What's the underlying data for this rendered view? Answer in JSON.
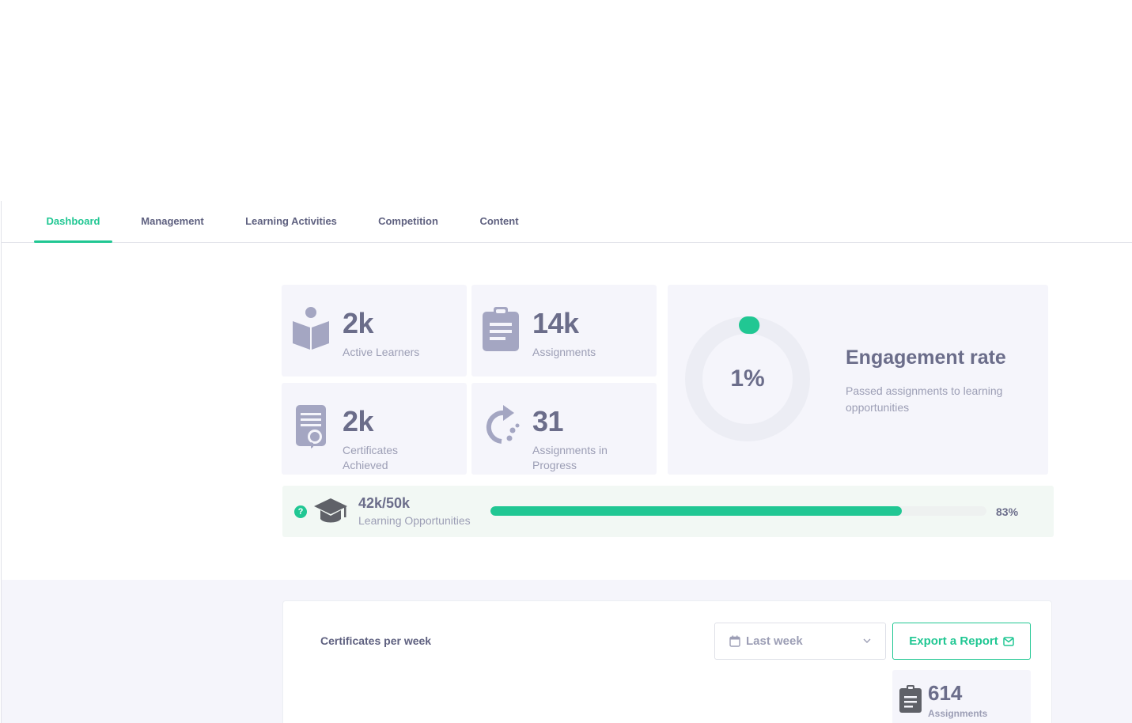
{
  "tabs": [
    {
      "label": "Dashboard",
      "active": true
    },
    {
      "label": "Management",
      "active": false
    },
    {
      "label": "Learning Activities",
      "active": false
    },
    {
      "label": "Competition",
      "active": false
    },
    {
      "label": "Content",
      "active": false
    }
  ],
  "stats": {
    "active_learners": {
      "value": "2k",
      "label": "Active Learners",
      "icon": "book-reader-icon"
    },
    "assignments": {
      "value": "14k",
      "label": "Assignments",
      "icon": "clipboard-icon"
    },
    "certificates": {
      "value": "2k",
      "label": "Certificates Achieved",
      "icon": "certificate-icon"
    },
    "in_progress": {
      "value": "31",
      "label": "Assignments in Progress",
      "icon": "progress-arrow-icon"
    }
  },
  "engagement": {
    "value": "1%",
    "percent": 1,
    "title": "Engagement rate",
    "subtitle": "Passed assignments to learning opportunities"
  },
  "opportunities": {
    "help": "?",
    "value": "42k/50k",
    "label": "Learning Opportunities",
    "percent_text": "83%",
    "percent": 83,
    "icon": "graduation-cap-icon"
  },
  "certificates_panel": {
    "title": "Certificates per week",
    "period_select": {
      "value": "Last week"
    },
    "export_label": "Export a Report",
    "mini_stat": {
      "value": "614",
      "label": "Assignments"
    }
  },
  "colors": {
    "accent": "#21c793",
    "text": "#6b6d8a",
    "muted": "#9c9eb5",
    "card_bg": "#f5f5fb",
    "icon": "#a4a6c2"
  }
}
